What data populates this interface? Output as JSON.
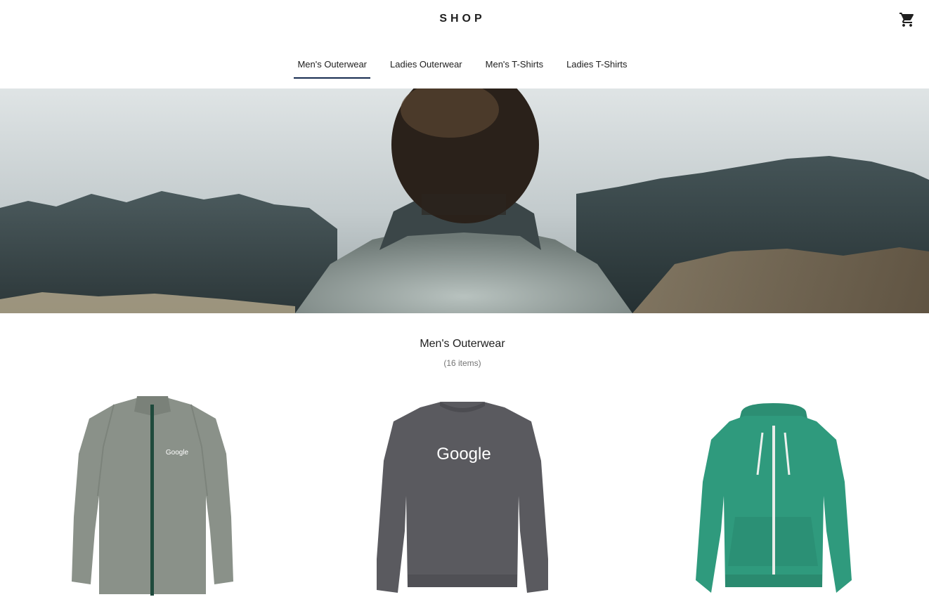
{
  "header": {
    "logo": "SHOP",
    "cart_icon": "shopping-cart-icon"
  },
  "tabs": [
    {
      "label": "Men's Outerwear",
      "active": true
    },
    {
      "label": "Ladies Outerwear",
      "active": false
    },
    {
      "label": "Men's T-Shirts",
      "active": false
    },
    {
      "label": "Ladies T-Shirts",
      "active": false
    }
  ],
  "hero": {
    "image": "hero-banner-man-in-sweater-foggy-landscape"
  },
  "category": {
    "title": "Men's Outerwear",
    "count": "(16 items)"
  },
  "products": [
    {
      "image": "grey-zip-jacket",
      "logo_text": "Google",
      "color": "#8a9189"
    },
    {
      "image": "charcoal-crewneck-sweatshirt",
      "logo_text": "Google",
      "color": "#5a5a5f"
    },
    {
      "image": "green-zip-hoodie",
      "color": "#2f9a7d"
    }
  ],
  "colors": {
    "accent": "#172c50",
    "text": "#202020",
    "muted": "#757575"
  }
}
